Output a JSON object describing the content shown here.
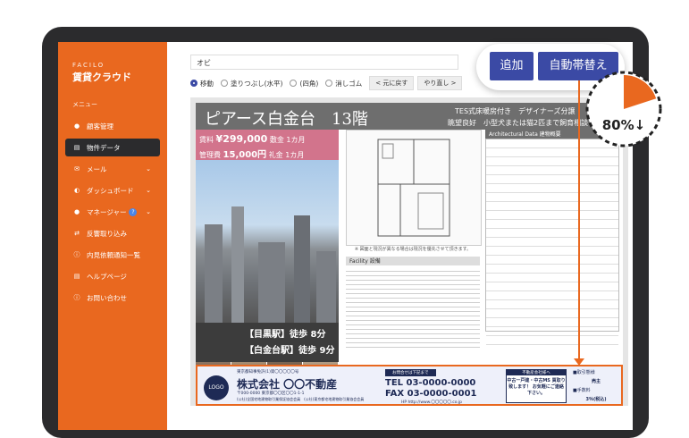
{
  "sidebar": {
    "logo_small": "FACILO",
    "logo_main": "賃貸クラウド",
    "menu_label": "メニュー",
    "items": [
      {
        "label": "顧客管理",
        "icon": "person-icon",
        "active": false,
        "chevron": false
      },
      {
        "label": "物件データ",
        "icon": "document-icon",
        "active": true,
        "chevron": false
      },
      {
        "label": "メール",
        "icon": "mail-icon",
        "active": false,
        "chevron": true
      },
      {
        "label": "ダッシュボード",
        "icon": "dashboard-icon",
        "active": false,
        "chevron": true
      },
      {
        "label": "マネージャー",
        "icon": "people-icon",
        "active": false,
        "chevron": true,
        "help": "?"
      },
      {
        "label": "反響取り込み",
        "icon": "import-icon",
        "active": false,
        "chevron": false
      },
      {
        "label": "内見依頼通知一覧",
        "icon": "info-icon",
        "active": false,
        "chevron": false
      },
      {
        "label": "ヘルプページ",
        "icon": "help-doc-icon",
        "active": false,
        "chevron": false
      },
      {
        "label": "お問い合わせ",
        "icon": "question-icon",
        "active": false,
        "chevron": false
      }
    ]
  },
  "editor": {
    "name_value": "オビ",
    "tools": [
      {
        "label": "移動",
        "checked": true
      },
      {
        "label": "塗りつぶし(水平)",
        "checked": false
      },
      {
        "label": "(四角)",
        "checked": false
      },
      {
        "label": "消しゴム",
        "checked": false
      }
    ],
    "undo_label": "< 元に戻す",
    "redo_label": "やり直し >"
  },
  "flyer": {
    "title": "ピアース白金台　13階",
    "tag1": "TES式床暖房付き　デザイナーズ分譲",
    "tag2": "眺望良好　小型犬または猫2匹まで飼育相談",
    "rent_label": "賃料",
    "rent": "¥299,000",
    "deposit": "敷金 1カ月",
    "mgmt_label": "管理費",
    "mgmt": "15,000円",
    "key_money": "礼金 1カ月",
    "station1": "【目黒駅】徒歩 8分",
    "station2": "【白金台駅】徒歩 9分",
    "plan_caption": "※ 図面と現況が異なる場合は現況を優先させて頂きます。",
    "facility_label": "Facility 設備",
    "spec_label": "Architectural Data 建物概要"
  },
  "banner": {
    "logo": "LOGO",
    "address": "東京都知事免許(1)第〇〇〇〇〇号",
    "company": "株式会社 〇〇不動産",
    "postal": "〒000-0000 東京都〇〇区〇〇1-1-1",
    "association": "(公社)全国宅地建物取引業保証協会会員　(公社)東京都宅地建物取引業協会会員",
    "contact_header": "お問合せは下記まで",
    "tel": "TEL 03-0000-0000",
    "fax": "FAX 03-0000-0001",
    "url": "HP http://www.〇〇〇〇〇.co.jp",
    "dealer_header": "不動産会社様へ",
    "dealer_text": "中古一戸建・中古MS 買取り致します！ お気軽にご連絡下さい。",
    "terms": [
      "■取引態様",
      "売主",
      "■手数料",
      "3％(税込)"
    ]
  },
  "actions": {
    "add_label": "追加",
    "auto_label": "自動帯替え"
  },
  "callout": {
    "percent_label": "80%↓",
    "value": 0.8,
    "accent": "#e9681f"
  },
  "colors": {
    "sidebar": "#e9681f",
    "primary_button": "#3b4aa5",
    "dark": "#2b2b2d"
  }
}
